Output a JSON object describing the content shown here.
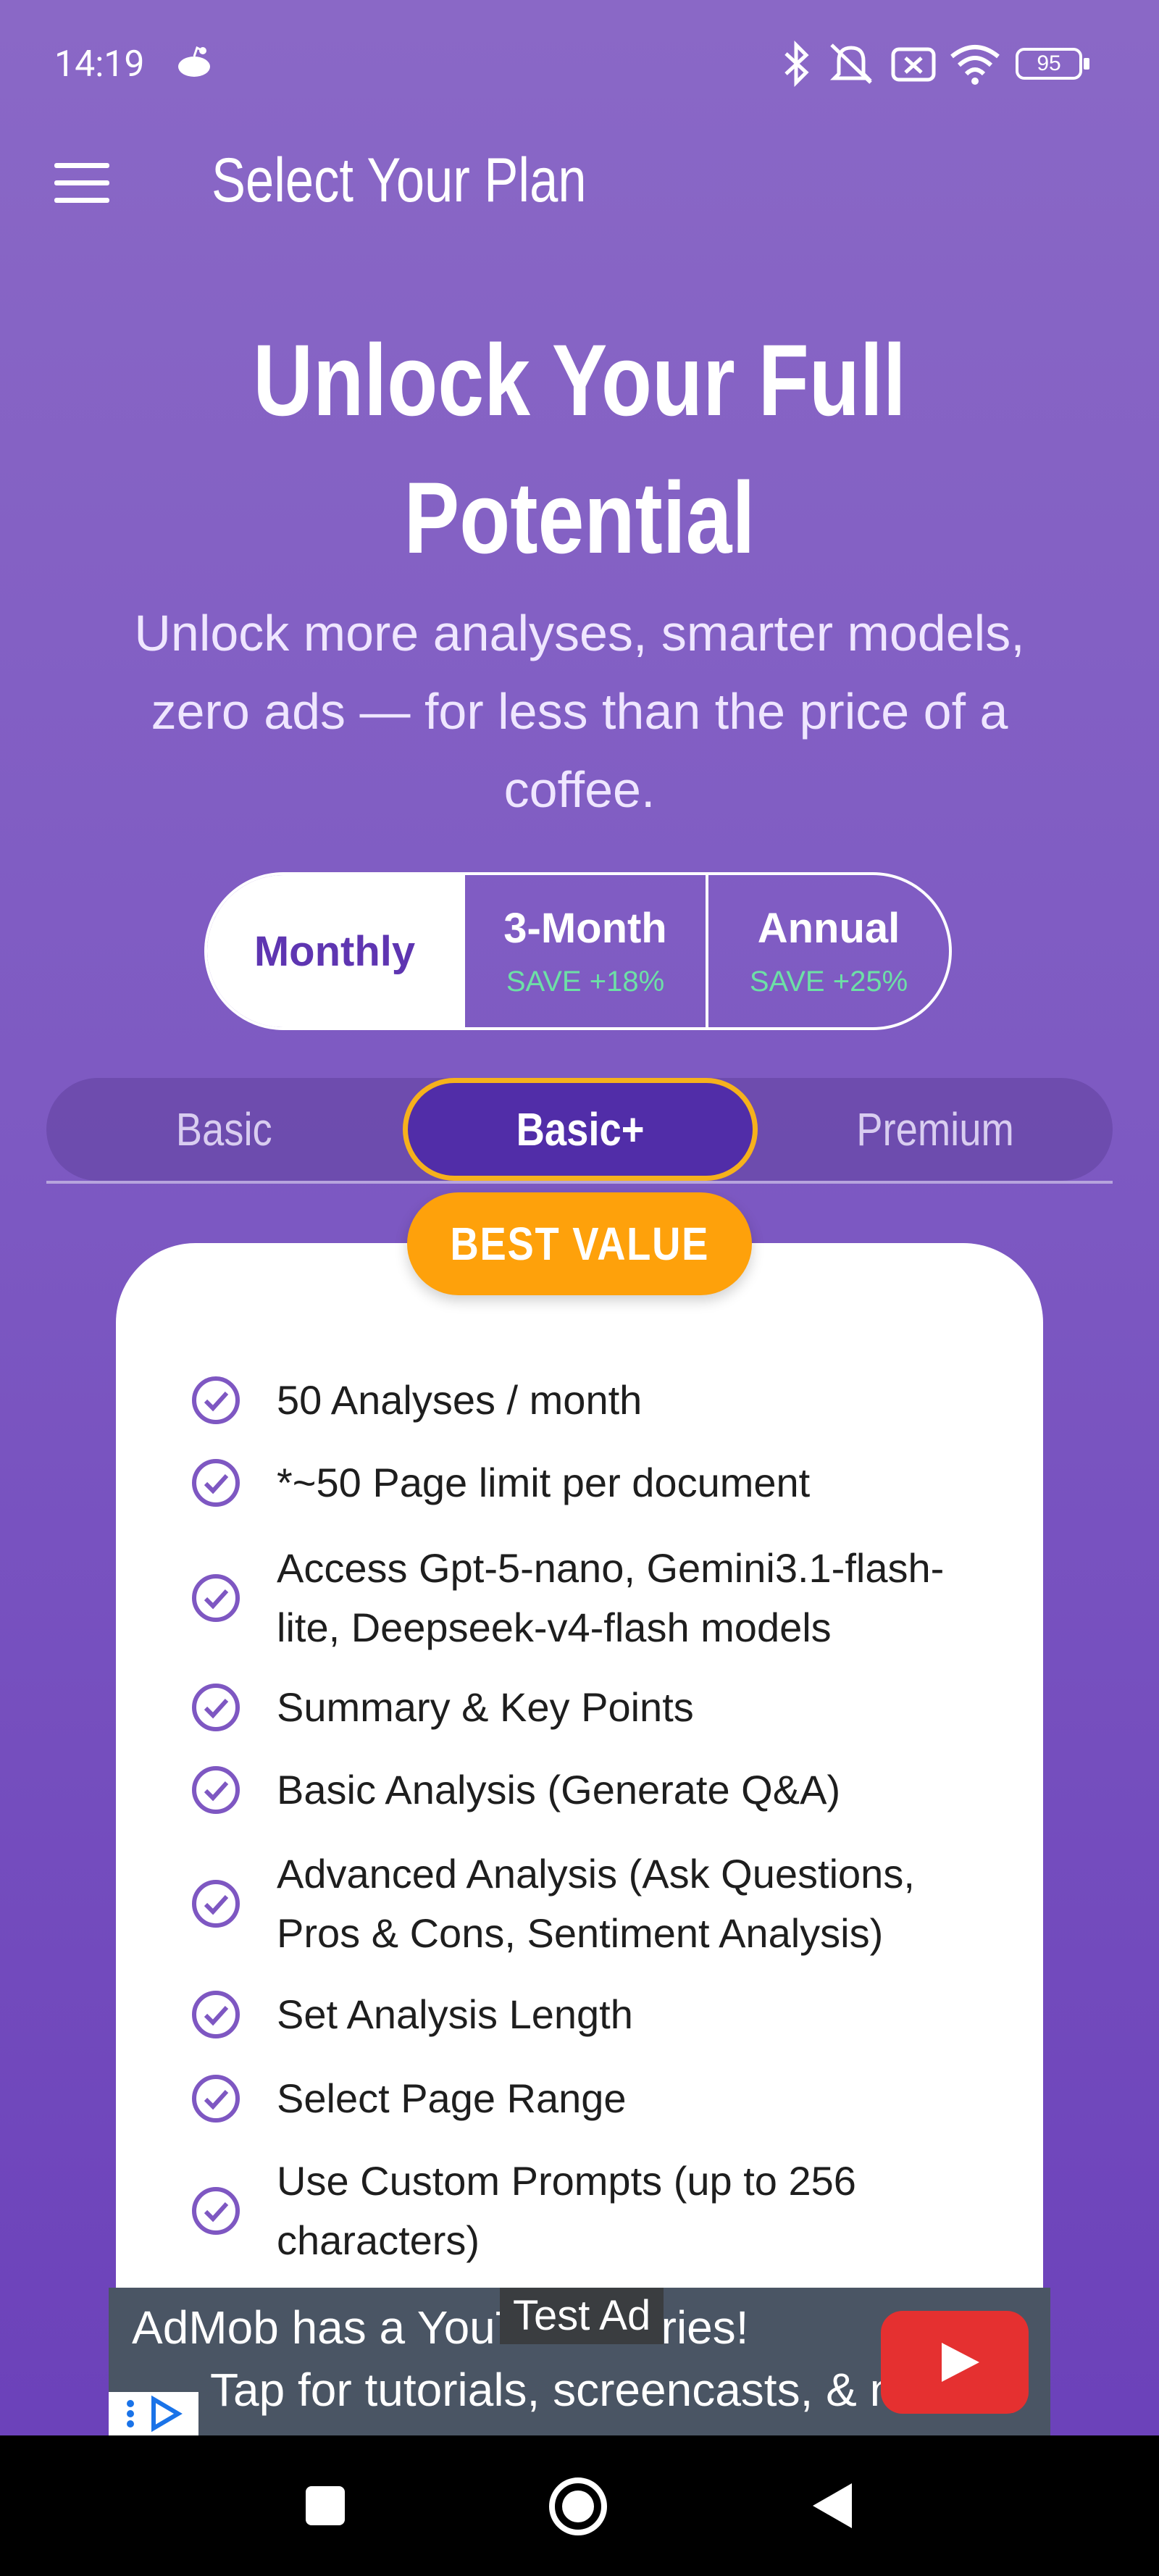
{
  "status_bar": {
    "time": "14:19",
    "battery": "95",
    "icons": [
      "reddit-icon",
      "bluetooth-icon",
      "mute-icon",
      "sim-off-icon",
      "wifi-icon",
      "battery-icon"
    ]
  },
  "app_bar": {
    "title": "Select Your Plan"
  },
  "hero": {
    "title_line1": "Unlock Your Full",
    "title_line2": "Potential",
    "subtitle_line1": "Unlock more analyses, smarter models,",
    "subtitle_line2": "zero ads — for less than the price of a",
    "subtitle_line3": "coffee."
  },
  "billing": {
    "options": [
      {
        "label": "Monthly",
        "save": ""
      },
      {
        "label": "3-Month",
        "save": "SAVE +18%"
      },
      {
        "label": "Annual",
        "save": "SAVE +25%"
      }
    ],
    "selected": "Monthly"
  },
  "tiers": {
    "items": [
      "Basic",
      "Basic+",
      "Premium"
    ],
    "selected": "Basic+"
  },
  "card": {
    "badge": "BEST VALUE",
    "features": [
      {
        "line1": "50 Analyses / month",
        "line2": ""
      },
      {
        "line1": "*~50 Page limit per document",
        "line2": ""
      },
      {
        "line1": "Access Gpt-5-nano, Gemini3.1-flash-",
        "line2": "lite, Deepseek-v4-flash models"
      },
      {
        "line1": "Summary & Key Points",
        "line2": ""
      },
      {
        "line1": "Basic Analysis (Generate Q&A)",
        "line2": ""
      },
      {
        "line1": "Advanced Analysis (Ask Questions,",
        "line2": "Pros & Cons, Sentiment Analysis)"
      },
      {
        "line1": "Set Analysis Length",
        "line2": ""
      },
      {
        "line1": "Select Page Range",
        "line2": ""
      },
      {
        "line1": "Use Custom Prompts (up to 256",
        "line2": "characters)"
      }
    ]
  },
  "ad": {
    "line1": "AdMob has a YouTube series!",
    "line2": "Tap for tutorials, screencasts, & more.",
    "tag": "Test Ad"
  },
  "colors": {
    "accent": "#5e35b1",
    "badge": "#fea10b",
    "selected_border": "#f6b11c",
    "save_text": "#6de0a6",
    "check": "#7e57c2"
  }
}
